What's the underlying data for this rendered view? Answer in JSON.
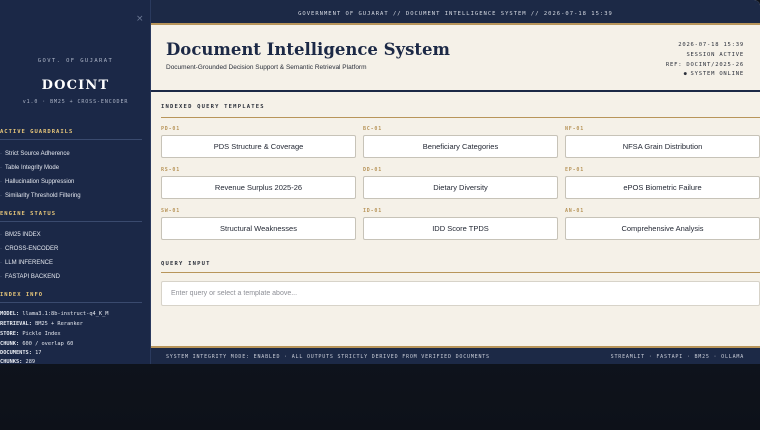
{
  "sidebar": {
    "close_glyph": "×",
    "govt": "GOVT. OF GUJARAT",
    "brand": "DOCINT",
    "version": "v1.0 · BM25 + CROSS-ENCODER",
    "guardrails_title": "ACTIVE GUARDRAILS",
    "guardrails": [
      "Strict Source Adherence",
      "Table Integrity Mode",
      "Hallucination Suppression",
      "Similarity Threshold Filtering"
    ],
    "engine_title": "ENGINE STATUS",
    "engine": [
      "BM25 INDEX",
      "CROSS-ENCODER",
      "LLM INFERENCE",
      "FASTAPI BACKEND"
    ],
    "index_title": "INDEX INFO",
    "index_info": [
      {
        "key": "MODEL:",
        "value": "llama3.1:8b-instruct-q4_K_M"
      },
      {
        "key": "RETRIEVAL:",
        "value": "BM25 + Reranker"
      },
      {
        "key": "STORE:",
        "value": "Pickle Index"
      },
      {
        "key": "CHUNK:",
        "value": "600 / overlap 60"
      },
      {
        "key": "DOCUMENTS:",
        "value": "17"
      },
      {
        "key": "CHUNKS:",
        "value": "289"
      }
    ]
  },
  "topbar": {
    "text": "GOVERNMENT OF GUJARAT  //  DOCUMENT INTELLIGENCE SYSTEM  //  2026-07-18 15:39"
  },
  "header": {
    "title": "Document Intelligence System",
    "subtitle": "Document-Grounded Decision Support & Semantic Retrieval Platform",
    "meta_time": "2026-07-18 15:39",
    "meta_session": "SESSION ACTIVE",
    "meta_ref": "REF: DOCINT/2025-26",
    "meta_status": "SYSTEM ONLINE",
    "status_dot": "●"
  },
  "templates_section": {
    "title": "INDEXED QUERY TEMPLATES",
    "items": [
      {
        "code": "PD-01",
        "label": "PDS Structure & Coverage"
      },
      {
        "code": "BC-01",
        "label": "Beneficiary Categories"
      },
      {
        "code": "NF-01",
        "label": "NFSA Grain Distribution"
      },
      {
        "code": "RS-01",
        "label": "Revenue Surplus 2025-26"
      },
      {
        "code": "DD-01",
        "label": "Dietary Diversity"
      },
      {
        "code": "EP-01",
        "label": "ePOS Biometric Failure"
      },
      {
        "code": "SW-01",
        "label": "Structural Weaknesses"
      },
      {
        "code": "ID-01",
        "label": "IDD Score TPDS"
      },
      {
        "code": "AN-01",
        "label": "Comprehensive Analysis"
      }
    ]
  },
  "query_section": {
    "title": "QUERY INPUT",
    "value": "",
    "placeholder": "Enter query or select a template above..."
  },
  "footer": {
    "left": "SYSTEM INTEGRITY MODE: ENABLED · ALL OUTPUTS STRICTLY DERIVED FROM VERIFIED DOCUMENTS",
    "right": "STREAMLIT · FASTAPI · BM25 · OLLAMA"
  },
  "colors": {
    "navy": "#1c2946",
    "gold": "#b8955a",
    "paper": "#f5f1e8"
  }
}
